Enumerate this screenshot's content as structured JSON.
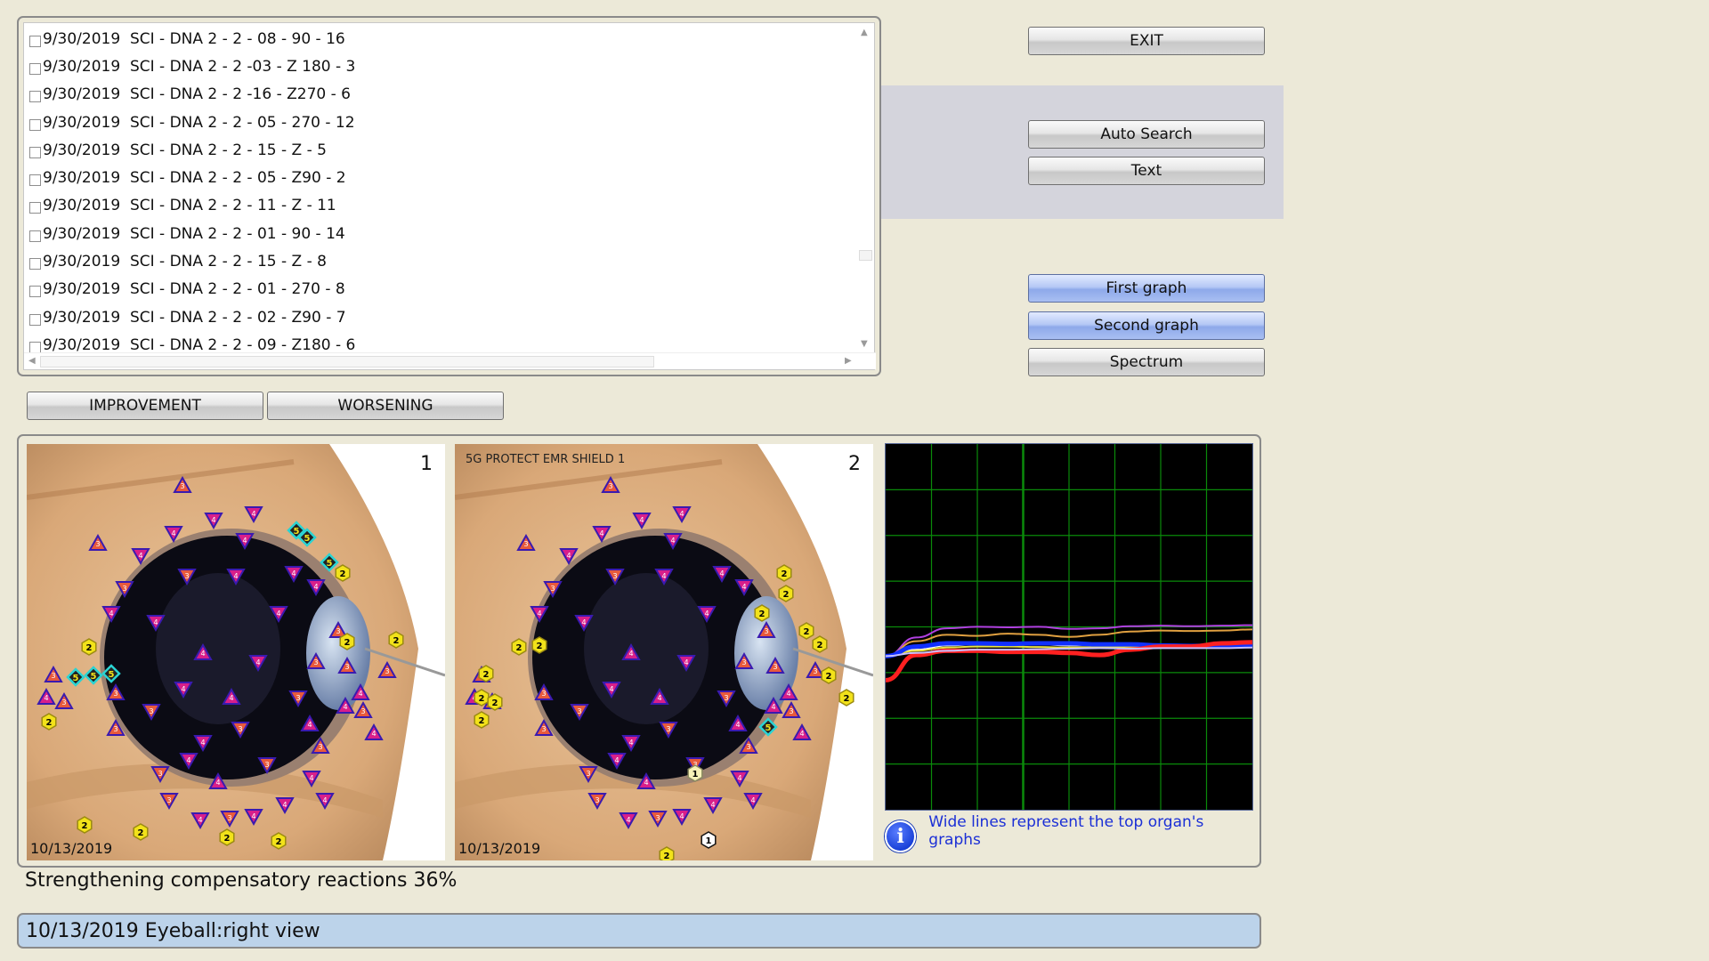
{
  "records": [
    "9/30/2019  SCI - DNA 2 - 2 - 08 - 90 - 16",
    "9/30/2019  SCI - DNA 2 - 2 -03 - Z 180 - 3",
    "9/30/2019  SCI - DNA 2 - 2 -16 - Z270 - 6",
    "9/30/2019  SCI - DNA 2 - 2 - 05 - 270 - 12",
    "9/30/2019  SCI - DNA 2 - 2 - 15 - Z - 5",
    "9/30/2019  SCI - DNA 2 - 2 - 05 - Z90 - 2",
    "9/30/2019  SCI - DNA 2 - 2 - 11 - Z - 11",
    "9/30/2019  SCI - DNA 2 - 2 - 01 - 90 - 14",
    "9/30/2019  SCI - DNA 2 - 2 - 15 - Z - 8",
    "9/30/2019  SCI - DNA 2 - 2 - 01 - 270 - 8",
    "9/30/2019  SCI - DNA 2 - 2 - 02 - Z90 - 7",
    "9/30/2019  SCI - DNA 2 - 2 - 09 - Z180 - 6"
  ],
  "buttons": {
    "exit": "EXIT",
    "auto_search": "Auto Search",
    "text": "Text",
    "first_graph": "First graph",
    "second_graph": "Second graph",
    "spectrum": "Spectrum",
    "improvement": "IMPROVEMENT",
    "worsening": "WORSENING"
  },
  "eye_panels": [
    {
      "number": "1",
      "date": "10/13/2019",
      "caption": ""
    },
    {
      "number": "2",
      "date": "10/13/2019",
      "caption": "5G PROTECT EMR SHIELD 1"
    }
  ],
  "info_text": "Wide lines represent the top organ's graphs",
  "status_text": "Strengthening compensatory reactions 36%",
  "footer_text": "10/13/2019 Eyeball:right view",
  "colors": {
    "marker_3": "#e85a3c",
    "marker_4": "#d81f8a",
    "marker_2": "#f2e21a",
    "marker_5": "#2ad3d3",
    "marker_1": "#f7f2b8",
    "grid": "#0a8a0a"
  },
  "chart_data": {
    "type": "line",
    "grid": true,
    "series": [
      {
        "color": "#b040e0",
        "wide": false,
        "values": [
          0.0,
          0.35,
          0.52,
          0.55,
          0.54,
          0.55,
          0.51,
          0.52,
          0.56,
          0.57,
          0.56,
          0.57,
          0.58
        ]
      },
      {
        "color": "#e0a040",
        "wide": false,
        "values": [
          0.0,
          0.28,
          0.4,
          0.38,
          0.42,
          0.4,
          0.36,
          0.4,
          0.46,
          0.48,
          0.47,
          0.48,
          0.5
        ]
      },
      {
        "color": "#ffffff",
        "wide": false,
        "values": [
          0.0,
          0.12,
          0.2,
          0.22,
          0.21,
          0.22,
          0.2,
          0.21,
          0.2,
          0.2,
          0.21,
          0.2,
          0.21
        ]
      },
      {
        "color": "#e8e040",
        "wide": false,
        "values": [
          0.0,
          0.1,
          0.16,
          0.18,
          0.18,
          0.17,
          0.16,
          0.17,
          0.17,
          0.18,
          0.18,
          0.19,
          0.19
        ]
      },
      {
        "color": "#1030ff",
        "wide": true,
        "values": [
          0.0,
          0.18,
          0.24,
          0.24,
          0.23,
          0.24,
          0.24,
          0.22,
          0.22,
          0.2,
          0.19,
          0.2,
          0.2
        ]
      },
      {
        "color": "#ff2020",
        "wide": true,
        "values": [
          -0.45,
          0.02,
          0.1,
          0.1,
          0.08,
          0.08,
          0.06,
          0.02,
          0.12,
          0.18,
          0.18,
          0.24,
          0.26
        ]
      },
      {
        "color": "#c8c0ff",
        "wide": false,
        "values": [
          0.0,
          0.06,
          0.1,
          0.12,
          0.12,
          0.13,
          0.14,
          0.15,
          0.14,
          0.15,
          0.15,
          0.15,
          0.16
        ]
      }
    ]
  }
}
